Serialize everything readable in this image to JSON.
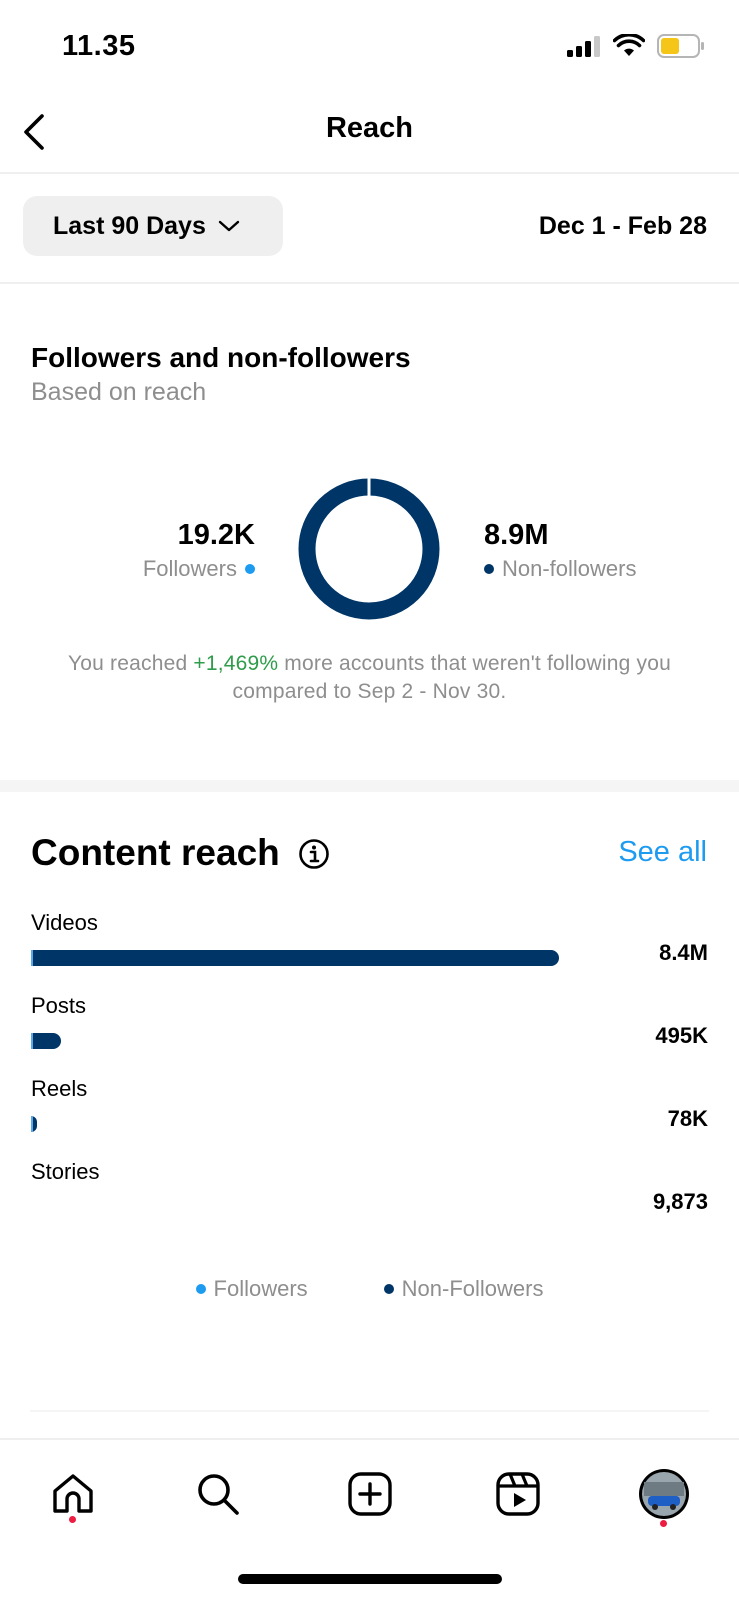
{
  "status_bar": {
    "time": "11.35",
    "battery_color": "#f5c518"
  },
  "header": {
    "title": "Reach",
    "back_icon": "chevron-left-icon"
  },
  "range": {
    "selector_label": "Last 90 Days",
    "dates": "Dec 1 - Feb 28"
  },
  "followers_section": {
    "title": "Followers and non-followers",
    "subtitle": "Based on reach",
    "followers": {
      "value": "19.2K",
      "label": "Followers",
      "color": "#1d9bf0",
      "fraction": 0.0021
    },
    "non_followers": {
      "value": "8.9M",
      "label": "Non-followers",
      "color": "#003567",
      "fraction": 0.9979
    },
    "summary_before": "You reached ",
    "summary_pct": "+1,469%",
    "summary_after": " more accounts that weren't following you compared to Sep 2 - Nov 30."
  },
  "content_reach": {
    "title": "Content reach",
    "see_all": "See all",
    "rows": [
      {
        "label": "Videos",
        "value": "8.4M",
        "fraction": 1.0
      },
      {
        "label": "Posts",
        "value": "495K",
        "fraction": 0.056
      },
      {
        "label": "Reels",
        "value": "78K",
        "fraction": 0.011
      },
      {
        "label": "Stories",
        "value": "9,873",
        "fraction": 0.0
      }
    ],
    "legend": [
      {
        "label": "Followers",
        "color": "#1d9bf0"
      },
      {
        "label": "Non-Followers",
        "color": "#003567"
      }
    ]
  },
  "tab_bar": {
    "tabs": [
      "home-icon",
      "search-icon",
      "create-icon",
      "reels-icon",
      "profile-avatar"
    ],
    "notification_color": "#ed1c40"
  }
}
